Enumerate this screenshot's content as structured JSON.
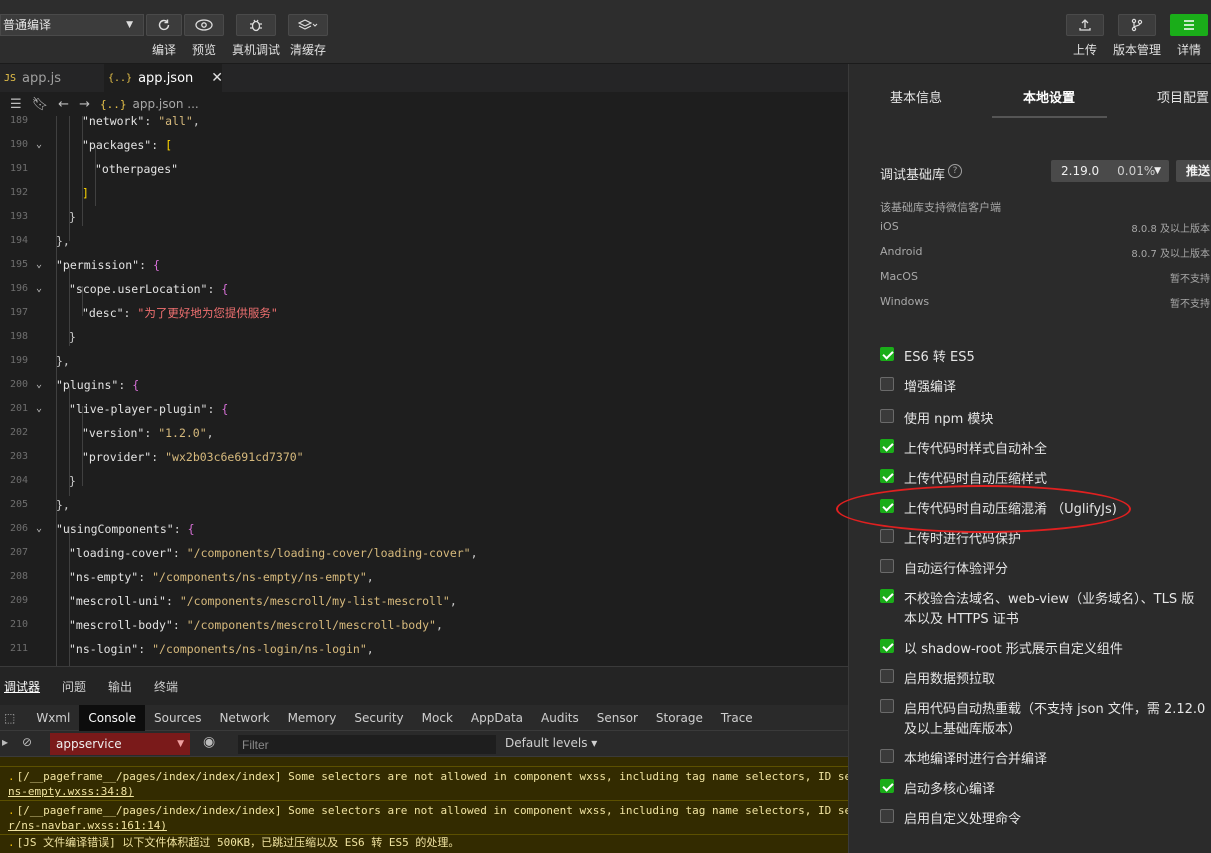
{
  "toolbar": {
    "mode_select": "普通编译",
    "compile_label": "编译",
    "preview_label": "预览",
    "remote_debug_label": "真机调试",
    "clear_cache_label": "清缓存",
    "upload_label": "上传",
    "version_label": "版本管理",
    "details_label": "详情",
    "accent_color": "#1aad19"
  },
  "editor": {
    "tabs": [
      {
        "icon": "JS",
        "label": "app.js"
      },
      {
        "icon": "{..}",
        "label": "app.json",
        "close": "✕"
      }
    ],
    "breadcrumb": {
      "icon": "{..}",
      "file": "app.json",
      "ellipsis": "..."
    },
    "lines": [
      {
        "n": "189",
        "text": "\"network\": \"all\","
      },
      {
        "n": "190",
        "text": "\"packages\": ["
      },
      {
        "n": "191",
        "text": "\"otherpages\""
      },
      {
        "n": "192",
        "text": "]"
      },
      {
        "n": "193",
        "text": "}"
      },
      {
        "n": "194",
        "text": "},"
      },
      {
        "n": "195",
        "text": "\"permission\": {"
      },
      {
        "n": "196",
        "text": "\"scope.userLocation\": {"
      },
      {
        "n": "197",
        "text": "\"desc\": \"为了更好地为您提供服务\""
      },
      {
        "n": "198",
        "text": "}"
      },
      {
        "n": "199",
        "text": "},"
      },
      {
        "n": "200",
        "text": "\"plugins\": {"
      },
      {
        "n": "201",
        "text": "\"live-player-plugin\": {"
      },
      {
        "n": "202",
        "text": "\"version\": \"1.2.0\","
      },
      {
        "n": "203",
        "text": "\"provider\": \"wx2b03c6e691cd7370\""
      },
      {
        "n": "204",
        "text": "}"
      },
      {
        "n": "205",
        "text": "},"
      },
      {
        "n": "206",
        "text": "\"usingComponents\": {"
      },
      {
        "n": "207",
        "text": "\"loading-cover\": \"/components/loading-cover/loading-cover\","
      },
      {
        "n": "208",
        "text": "\"ns-empty\": \"/components/ns-empty/ns-empty\","
      },
      {
        "n": "209",
        "text": "\"mescroll-uni\": \"/components/mescroll/my-list-mescroll\","
      },
      {
        "n": "210",
        "text": "\"mescroll-body\": \"/components/mescroll/mescroll-body\","
      },
      {
        "n": "211",
        "text": "\"ns-login\": \"/components/ns-login/ns-login\","
      }
    ]
  },
  "devtools": {
    "top_tabs": [
      "调试器",
      "问题",
      "输出",
      "终端"
    ],
    "panel_tabs": [
      "Wxml",
      "Console",
      "Sources",
      "Network",
      "Memory",
      "Security",
      "Mock",
      "AppData",
      "Audits",
      "Sensor",
      "Storage",
      "Trace"
    ],
    "active_panel": "Console",
    "context": "appservice",
    "filter_placeholder": "Filter",
    "levels": "Default levels ▾",
    "messages": [
      {
        "text": "[/__pageframe__/pages/index/index/index] Some selectors are not allowed in component wxss, including tag name selectors, ID selectors",
        "link": "ns-empty.wxss:34:8)"
      },
      {
        "text": "[/__pageframe__/pages/index/index/index] Some selectors are not allowed in component wxss, including tag name selectors, ID selectors",
        "link": "r/ns-navbar.wxss:161:14)"
      },
      {
        "text": "[JS 文件编译错误] 以下文件体积超过 500KB，已跳过压缩以及 ES6 转 ES5 的处理。"
      }
    ]
  },
  "settings": {
    "tabs": [
      "基本信息",
      "本地设置",
      "项目配置"
    ],
    "active_tab": "本地设置",
    "lib_label": "调试基础库",
    "lib_version": "2.19.0",
    "lib_percent": "0.01%",
    "push_label": "推送",
    "lib_support": "该基础库支持微信客户端",
    "platforms": [
      {
        "name": "iOS",
        "value": "8.0.8 及以上版本"
      },
      {
        "name": "Android",
        "value": "8.0.7 及以上版本"
      },
      {
        "name": "MacOS",
        "value": "暂不支持"
      },
      {
        "name": "Windows",
        "value": "暂不支持"
      }
    ],
    "options": [
      {
        "label": "ES6 转 ES5",
        "checked": true
      },
      {
        "label": "增强编译",
        "checked": false
      },
      {
        "label": "使用 npm 模块",
        "checked": false
      },
      {
        "label": "上传代码时样式自动补全",
        "checked": true
      },
      {
        "label": "上传代码时自动压缩样式",
        "checked": true
      },
      {
        "label": "上传代码时自动压缩混淆 （UglifyJs)",
        "checked": true
      },
      {
        "label": "上传时进行代码保护",
        "checked": false
      },
      {
        "label": "自动运行体验评分",
        "checked": false
      },
      {
        "label": "不校验合法域名、web-view（业务域名）、TLS 版",
        "label2": "本以及 HTTPS 证书",
        "checked": true
      },
      {
        "label": "以 shadow-root 形式展示自定义组件",
        "checked": true
      },
      {
        "label": "启用数据预拉取",
        "checked": false
      },
      {
        "label": "启用代码自动热重载（不支持 json 文件，需 2.12.0",
        "label2": "及以上基础库版本）",
        "checked": false
      },
      {
        "label": "本地编译时进行合并编译",
        "checked": false
      },
      {
        "label": "启动多核心编译",
        "checked": true
      },
      {
        "label": "启用自定义处理命令",
        "checked": false
      }
    ]
  }
}
